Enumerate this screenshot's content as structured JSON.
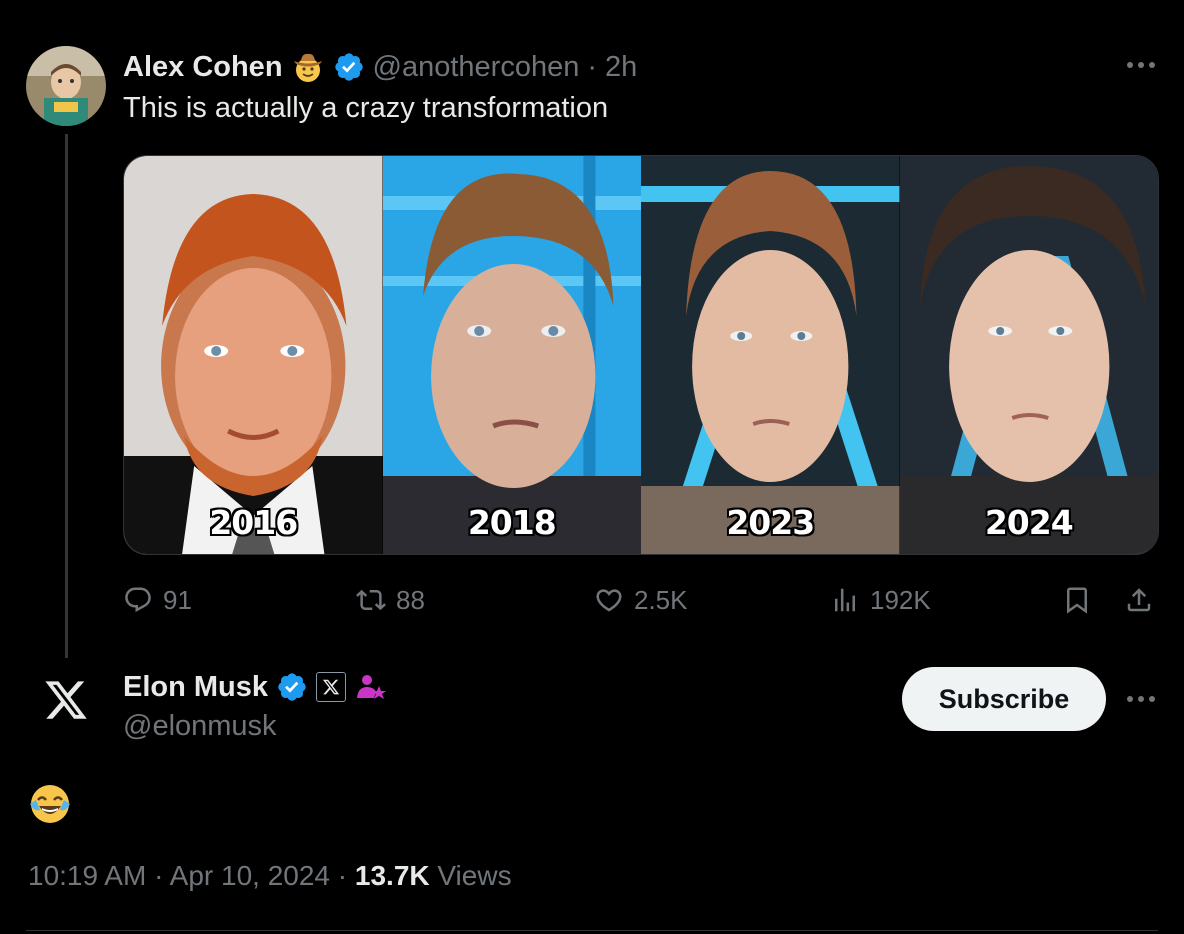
{
  "post": {
    "author_name": "Alex Cohen",
    "handle": "@anothercohen",
    "separator": "·",
    "time_ago": "2h",
    "text": "This is actually a crazy transformation",
    "author_badge_icon": "cowboy-hat-face-icon",
    "verified_icon": "verified-badge-icon",
    "media": {
      "panels": [
        {
          "year": "2016"
        },
        {
          "year": "2018"
        },
        {
          "year": "2023"
        },
        {
          "year": "2024"
        }
      ]
    },
    "actions": {
      "replies": "91",
      "reposts": "88",
      "likes": "2.5K",
      "views": "192K"
    }
  },
  "reply": {
    "author_name": "Elon Musk",
    "handle": "@elonmusk",
    "subscribe_label": "Subscribe",
    "content_emoji": "face-with-tears-of-joy",
    "time": "10:19 AM",
    "sep1": "·",
    "date": "Apr 10, 2024",
    "sep2": "·",
    "views_count": "13.7K",
    "views_label": "Views"
  },
  "colors": {
    "background": "#000000",
    "text_primary": "#e7e9ea",
    "text_secondary": "#71767b",
    "verified_blue": "#1d9bf0",
    "border": "#2f3336"
  }
}
